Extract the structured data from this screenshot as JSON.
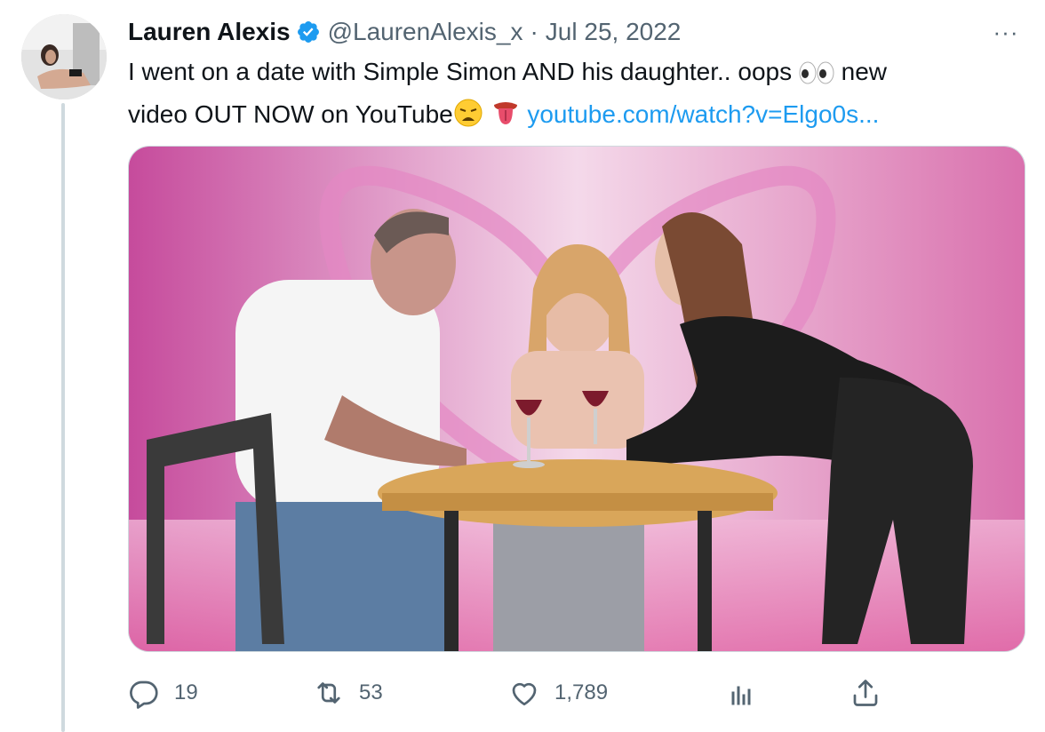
{
  "tweet": {
    "author": {
      "display_name": "Lauren Alexis",
      "handle": "@LaurenAlexis_x",
      "verified": true
    },
    "separator": "·",
    "date": "Jul 25, 2022",
    "more_label": "···",
    "text_line1": "I went on a date with Simple Simon AND his daughter.. oops",
    "text_line1_tail": "new",
    "text_line2": "video OUT NOW on YouTube",
    "link": "youtube.com/watch?v=Elgo0s...",
    "emojis": [
      "eyes-emoji",
      "weary-face-emoji",
      "tongue-emoji"
    ],
    "media": {
      "type": "image",
      "description_icon": "photo"
    },
    "actions": {
      "reply_count": "19",
      "retweet_count": "53",
      "like_count": "1,789",
      "views_icon": "bar-chart-icon",
      "share_icon": "share-icon"
    }
  },
  "colors": {
    "link": "#1d9bf0",
    "secondary_text": "#536471",
    "verified_badge": "#1d9bf0",
    "media_pink": "#e58fc4"
  }
}
